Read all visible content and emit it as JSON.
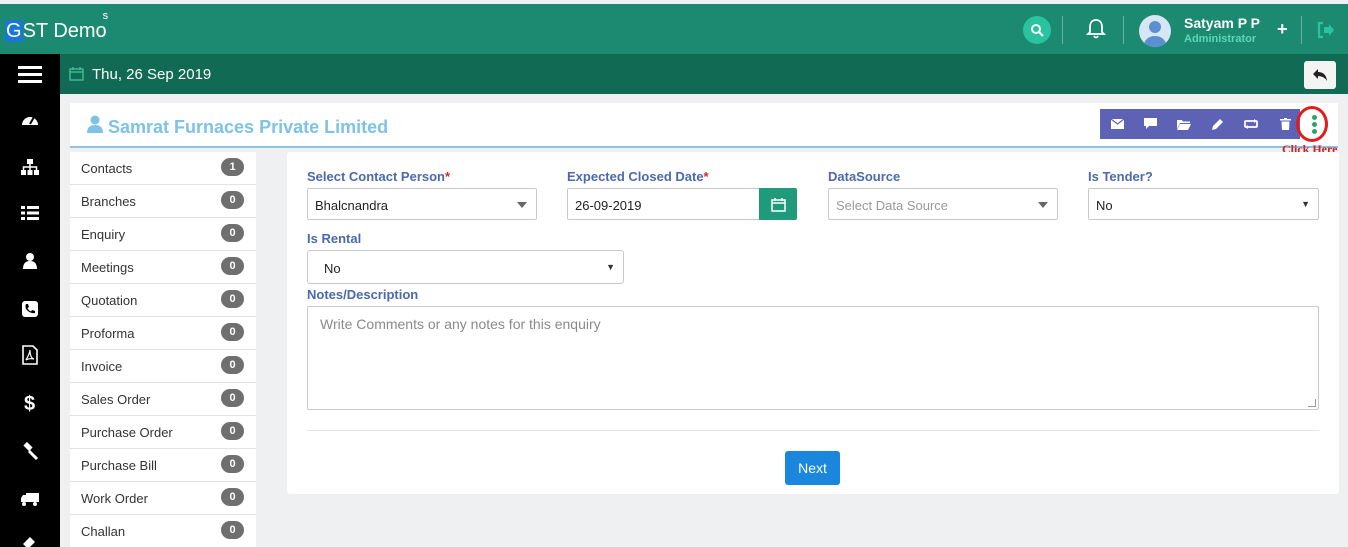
{
  "app": {
    "brand": "GST Demo",
    "brand_first": "G",
    "brand_rest": "ST Demo",
    "brand_sup": "s"
  },
  "header": {
    "user_name": "Satyam P P",
    "user_role": "Administrator",
    "plus_label": "+"
  },
  "subbar": {
    "date": "Thu, 26 Sep 2019"
  },
  "sidebar": {
    "icons": [
      "dashboard-icon",
      "sitemap-icon",
      "list-icon",
      "user-icon",
      "phone-icon",
      "pdf-icon",
      "dollar-icon",
      "gavel-icon",
      "truck-icon",
      "tag-icon"
    ]
  },
  "company": {
    "name": "Samrat Furnaces Private Limited",
    "annotation": "Click Here"
  },
  "actions": [
    "envelope-icon",
    "comment-icon",
    "folder-icon",
    "pencil-icon",
    "exchange-icon",
    "trash-icon"
  ],
  "list": [
    {
      "label": "Contacts",
      "count": "1"
    },
    {
      "label": "Branches",
      "count": "0"
    },
    {
      "label": "Enquiry",
      "count": "0"
    },
    {
      "label": "Meetings",
      "count": "0"
    },
    {
      "label": "Quotation",
      "count": "0"
    },
    {
      "label": "Proforma",
      "count": "0"
    },
    {
      "label": "Invoice",
      "count": "0"
    },
    {
      "label": "Sales Order",
      "count": "0"
    },
    {
      "label": "Purchase Order",
      "count": "0"
    },
    {
      "label": "Purchase Bill",
      "count": "0"
    },
    {
      "label": "Work Order",
      "count": "0"
    },
    {
      "label": "Challan",
      "count": "0"
    }
  ],
  "form": {
    "contact_label": "Select Contact Person",
    "required_mark": "*",
    "contact_value": "Bhalcnandra",
    "date_label": "Expected Closed Date",
    "date_value": "26-09-2019",
    "datasource_label": "DataSource",
    "datasource_placeholder": "Select Data Source",
    "tender_label": "Is Tender?",
    "tender_value": "No",
    "rental_label": "Is Rental",
    "rental_value": "No",
    "notes_label": "Notes/Description",
    "notes_placeholder": "Write Comments or any notes for this enquiry",
    "next_label": "Next"
  },
  "colors": {
    "header": "#1b8a71",
    "subbar": "#116a53",
    "action_bar": "#5d62b5",
    "primary_button": "#1a87dd",
    "label": "#4b69ae"
  }
}
